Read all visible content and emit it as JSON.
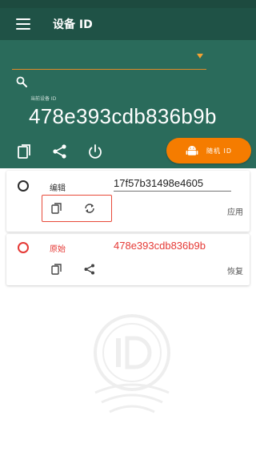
{
  "app": {
    "title": "设备 ID"
  },
  "header": {
    "current_label": "当前设备 ID",
    "current_id": "478e393cdb836b9b",
    "random_button_label": "随机 ID",
    "accent_color": "#f57c00"
  },
  "cards": [
    {
      "label": "编辑",
      "value": "17f57b31498e4605",
      "action": "应用"
    },
    {
      "label": "原始",
      "value": "478e393cdb836b9b",
      "action": "恢复"
    }
  ],
  "icons": [
    "menu-icon",
    "dropdown-arrow-icon",
    "search-icon",
    "copy-icon",
    "share-icon",
    "power-icon",
    "android-icon",
    "refresh-icon",
    "watermark-logo-icon"
  ]
}
